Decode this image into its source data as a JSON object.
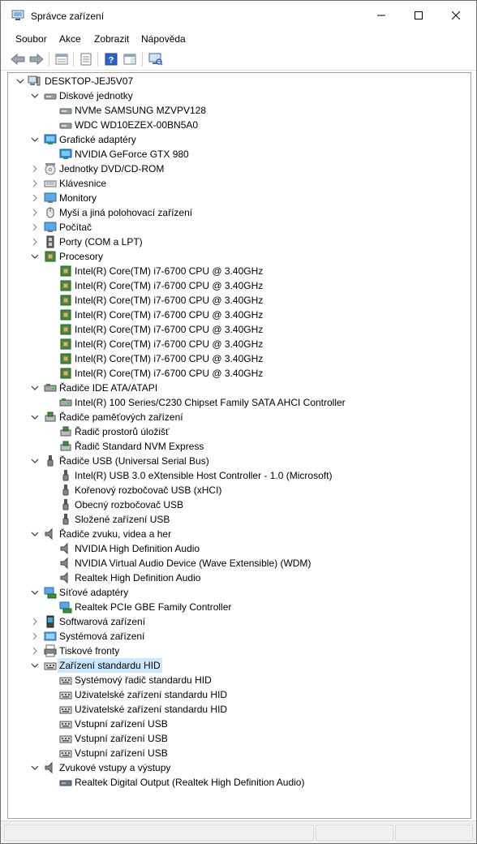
{
  "window": {
    "title": "Správce zařízení",
    "controls": [
      "minimize",
      "maximize",
      "close"
    ]
  },
  "menu": [
    "Soubor",
    "Akce",
    "Zobrazit",
    "Nápověda"
  ],
  "toolbar": [
    "back-icon",
    "forward-icon",
    "properties-list-icon",
    "details-icon",
    "help-icon",
    "action-pane-icon",
    "scan-hardware-icon"
  ],
  "tree": [
    {
      "label": "DESKTOP-JEJ5V07",
      "level": 0,
      "expander": "open",
      "icon": "computer"
    },
    {
      "label": "Diskové jednotky",
      "level": 1,
      "expander": "open",
      "icon": "disk"
    },
    {
      "label": "NVMe SAMSUNG MZVPV128",
      "level": 2,
      "expander": "none",
      "icon": "disk"
    },
    {
      "label": "WDC WD10EZEX-00BN5A0",
      "level": 2,
      "expander": "none",
      "icon": "disk"
    },
    {
      "label": "Grafické adaptéry",
      "level": 1,
      "expander": "open",
      "icon": "display"
    },
    {
      "label": "NVIDIA GeForce GTX 980",
      "level": 2,
      "expander": "none",
      "icon": "display"
    },
    {
      "label": "Jednotky DVD/CD-ROM",
      "level": 1,
      "expander": "closed",
      "icon": "dvd"
    },
    {
      "label": "Klávesnice",
      "level": 1,
      "expander": "closed",
      "icon": "keyboard"
    },
    {
      "label": "Monitory",
      "level": 1,
      "expander": "closed",
      "icon": "monitor"
    },
    {
      "label": "Myši a jiná polohovací zařízení",
      "level": 1,
      "expander": "closed",
      "icon": "mouse"
    },
    {
      "label": "Počítač",
      "level": 1,
      "expander": "closed",
      "icon": "monitor"
    },
    {
      "label": "Porty (COM a LPT)",
      "level": 1,
      "expander": "closed",
      "icon": "port"
    },
    {
      "label": "Procesory",
      "level": 1,
      "expander": "open",
      "icon": "cpu"
    },
    {
      "label": "Intel(R) Core(TM) i7-6700 CPU @ 3.40GHz",
      "level": 2,
      "expander": "none",
      "icon": "cpu"
    },
    {
      "label": "Intel(R) Core(TM) i7-6700 CPU @ 3.40GHz",
      "level": 2,
      "expander": "none",
      "icon": "cpu"
    },
    {
      "label": "Intel(R) Core(TM) i7-6700 CPU @ 3.40GHz",
      "level": 2,
      "expander": "none",
      "icon": "cpu"
    },
    {
      "label": "Intel(R) Core(TM) i7-6700 CPU @ 3.40GHz",
      "level": 2,
      "expander": "none",
      "icon": "cpu"
    },
    {
      "label": "Intel(R) Core(TM) i7-6700 CPU @ 3.40GHz",
      "level": 2,
      "expander": "none",
      "icon": "cpu"
    },
    {
      "label": "Intel(R) Core(TM) i7-6700 CPU @ 3.40GHz",
      "level": 2,
      "expander": "none",
      "icon": "cpu"
    },
    {
      "label": "Intel(R) Core(TM) i7-6700 CPU @ 3.40GHz",
      "level": 2,
      "expander": "none",
      "icon": "cpu"
    },
    {
      "label": "Intel(R) Core(TM) i7-6700 CPU @ 3.40GHz",
      "level": 2,
      "expander": "none",
      "icon": "cpu"
    },
    {
      "label": "Řadiče IDE ATA/ATAPI",
      "level": 1,
      "expander": "open",
      "icon": "ide"
    },
    {
      "label": "Intel(R) 100 Series/C230 Chipset Family SATA AHCI Controller",
      "level": 2,
      "expander": "none",
      "icon": "ide"
    },
    {
      "label": "Řadiče paměťových zařízení",
      "level": 1,
      "expander": "open",
      "icon": "storage"
    },
    {
      "label": "Řadič prostorů úložišť",
      "level": 2,
      "expander": "none",
      "icon": "storage"
    },
    {
      "label": "Řadič Standard NVM Express",
      "level": 2,
      "expander": "none",
      "icon": "storage"
    },
    {
      "label": "Řadiče USB (Universal Serial Bus)",
      "level": 1,
      "expander": "open",
      "icon": "usb"
    },
    {
      "label": "Intel(R) USB 3.0 eXtensible Host Controller - 1.0 (Microsoft)",
      "level": 2,
      "expander": "none",
      "icon": "usb"
    },
    {
      "label": "Kořenový rozbočovač USB (xHCI)",
      "level": 2,
      "expander": "none",
      "icon": "usb"
    },
    {
      "label": "Obecný rozbočovač USB",
      "level": 2,
      "expander": "none",
      "icon": "usb"
    },
    {
      "label": "Složené zařízení USB",
      "level": 2,
      "expander": "none",
      "icon": "usb"
    },
    {
      "label": "Řadiče zvuku, videa a her",
      "level": 1,
      "expander": "open",
      "icon": "sound"
    },
    {
      "label": "NVIDIA High Definition Audio",
      "level": 2,
      "expander": "none",
      "icon": "sound"
    },
    {
      "label": "NVIDIA Virtual Audio Device (Wave Extensible) (WDM)",
      "level": 2,
      "expander": "none",
      "icon": "sound"
    },
    {
      "label": "Realtek High Definition Audio",
      "level": 2,
      "expander": "none",
      "icon": "sound"
    },
    {
      "label": "Síťové adaptéry",
      "level": 1,
      "expander": "open",
      "icon": "network"
    },
    {
      "label": "Realtek PCIe GBE Family Controller",
      "level": 2,
      "expander": "none",
      "icon": "network"
    },
    {
      "label": "Softwarová zařízení",
      "level": 1,
      "expander": "closed",
      "icon": "software"
    },
    {
      "label": "Systémová zařízení",
      "level": 1,
      "expander": "closed",
      "icon": "system"
    },
    {
      "label": "Tiskové fronty",
      "level": 1,
      "expander": "closed",
      "icon": "printer"
    },
    {
      "label": "Zařízení standardu HID",
      "level": 1,
      "expander": "open",
      "icon": "hid",
      "selected": true
    },
    {
      "label": "Systémový řadič standardu HID",
      "level": 2,
      "expander": "none",
      "icon": "hid"
    },
    {
      "label": "Uživatelské zařízení standardu HID",
      "level": 2,
      "expander": "none",
      "icon": "hid"
    },
    {
      "label": "Uživatelské zařízení standardu HID",
      "level": 2,
      "expander": "none",
      "icon": "hid"
    },
    {
      "label": "Vstupní zařízení USB",
      "level": 2,
      "expander": "none",
      "icon": "hid"
    },
    {
      "label": "Vstupní zařízení USB",
      "level": 2,
      "expander": "none",
      "icon": "hid"
    },
    {
      "label": "Vstupní zařízení USB",
      "level": 2,
      "expander": "none",
      "icon": "hid"
    },
    {
      "label": "Zvukové vstupy a výstupy",
      "level": 1,
      "expander": "open",
      "icon": "sound"
    },
    {
      "label": "Realtek Digital Output (Realtek High Definition Audio)",
      "level": 2,
      "expander": "none",
      "icon": "audio-output"
    }
  ]
}
